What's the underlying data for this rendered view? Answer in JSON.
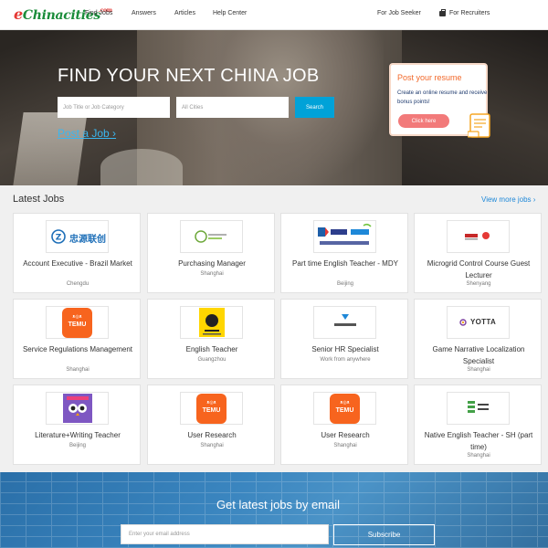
{
  "brand": {
    "logo_e": "e",
    "logo_text": "Chinacities",
    "logo_com": ".com",
    "green": "#1a8c3a",
    "red": "#e53935"
  },
  "nav": {
    "links": [
      "Find Jobs",
      "Answers",
      "Articles",
      "Help Center"
    ],
    "job_seeker": "For Job Seeker",
    "recruiters": "For Recruiters"
  },
  "hero": {
    "title": "FIND YOUR NEXT CHINA JOB",
    "keyword_placeholder": "Job Title or Job Category",
    "city_placeholder": "All Cities",
    "search_label": "Search",
    "post_job": "Post a Job ›"
  },
  "resume_card": {
    "title": "Post your resume",
    "text": "Create an online resume and receive bonus points!",
    "button": "Click here"
  },
  "latest": {
    "title": "Latest Jobs",
    "view_more": "View more jobs ›",
    "jobs": [
      {
        "title": "Account Executive - Brazil Market",
        "location": "Chengdu",
        "logo": "zhongyuan-logo",
        "logo_text": "忠源联创"
      },
      {
        "title": "Purchasing Manager",
        "location": "Shanghai",
        "logo": "covestro-logo",
        "logo_text": ""
      },
      {
        "title": "Part time English Teacher - MDY",
        "location": "Beijing",
        "logo": "elan-logo",
        "logo_text": ""
      },
      {
        "title": "Microgrid Control Course Guest Lecturer",
        "location": "Shenyang",
        "logo": "microgrid-logo",
        "logo_text": ""
      },
      {
        "title": "Service Regulations Management",
        "location": "Shanghai",
        "logo": "temu-logo",
        "logo_text": "TEMU"
      },
      {
        "title": "English Teacher",
        "location": "Guangzhou",
        "logo": "school-logo",
        "logo_text": ""
      },
      {
        "title": "Senior HR Specialist",
        "location": "Work from anywhere",
        "logo": "culture-logo",
        "logo_text": ""
      },
      {
        "title": "Game Narrative Localization Specialist",
        "location": "Shanghai",
        "logo": "yotta-logo",
        "logo_text": "YOTTA"
      },
      {
        "title": "Literature+Writing Teacher",
        "location": "Beijing",
        "logo": "owl-logo",
        "logo_text": ""
      },
      {
        "title": "User Research",
        "location": "Shanghai",
        "logo": "temu-logo",
        "logo_text": "TEMU"
      },
      {
        "title": "User Research",
        "location": "Shanghai",
        "logo": "temu-logo",
        "logo_text": "TEMU"
      },
      {
        "title": "Native English Teacher - SH (part time)",
        "location": "Shanghai",
        "logo": "sh-school-logo",
        "logo_text": ""
      }
    ]
  },
  "email": {
    "title": "Get latest jobs by email",
    "placeholder": "Enter your email address",
    "button": "Subscribe"
  },
  "colors": {
    "accent": "#00a2d8",
    "link": "#1e88d8",
    "temu": "#f7641e",
    "resume_orange": "#f2692b",
    "resume_btn": "#f27a7a"
  }
}
